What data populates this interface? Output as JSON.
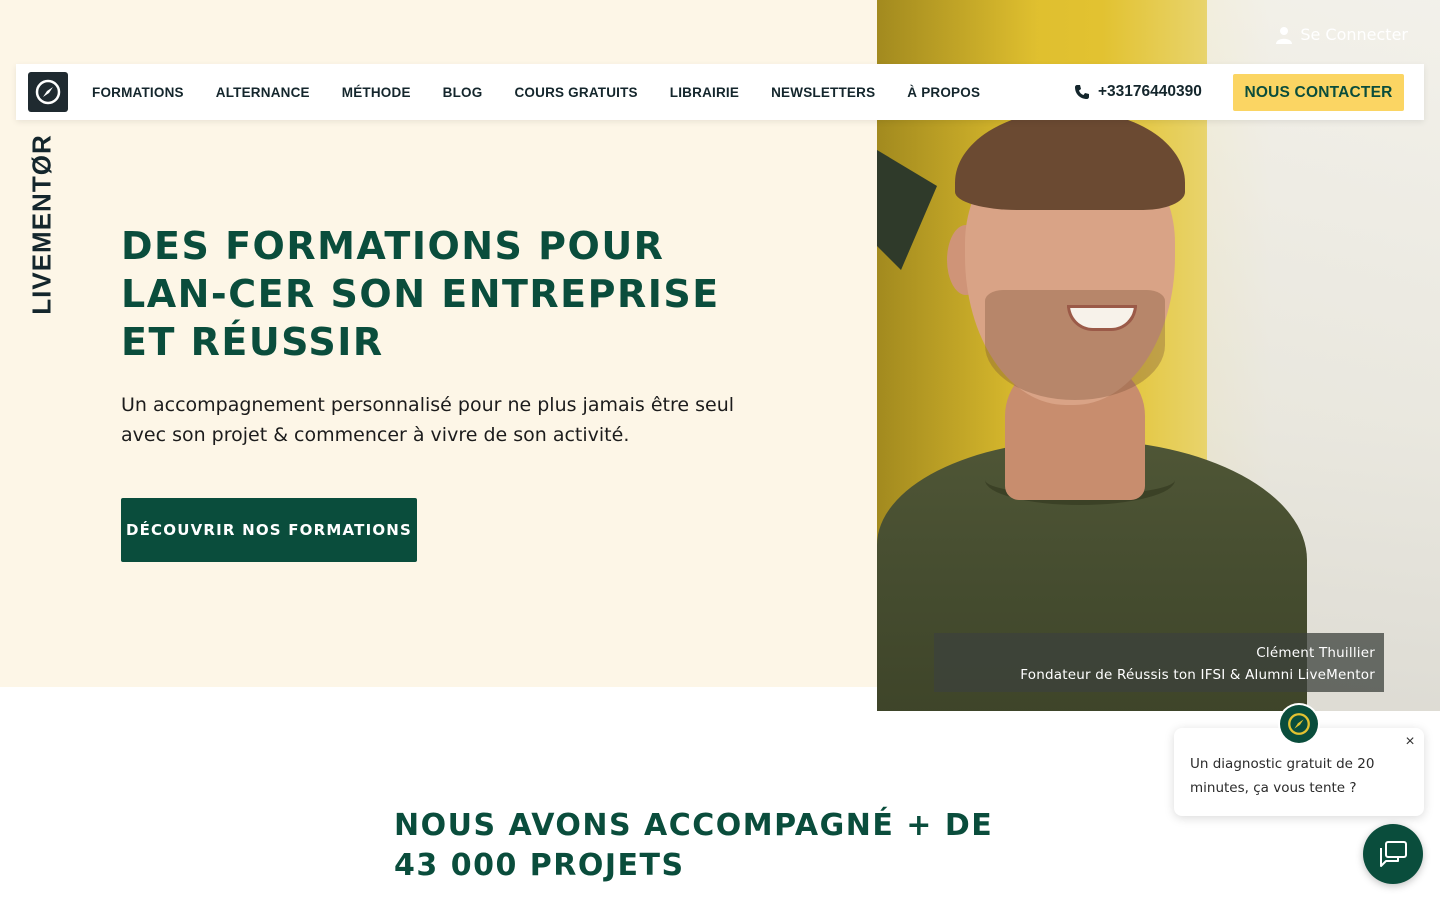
{
  "header": {
    "login_label": "Se Connecter",
    "brand_vertical": "LIVEMENTØR",
    "nav": [
      "FORMATIONS",
      "ALTERNANCE",
      "MÉTHODE",
      "BLOG",
      "COURS GRATUITS",
      "LIBRAIRIE",
      "NEWSLETTERS",
      "À PROPOS"
    ],
    "phone": "+33176440390",
    "contact_label": "NOUS CONTACTER"
  },
  "hero": {
    "title": "DES FORMATIONS POUR LAN-CER SON ENTREPRISE ET RÉUSSIR",
    "subtitle": "Un accompagnement personnalisé pour ne plus jamais être seul avec son projet & commencer à vivre de son activité.",
    "cta_label": "DÉCOUVRIR NOS FORMATIONS",
    "caption_name": "Clément Thuillier",
    "caption_role": "Fondateur de Réussis ton IFSI & Alumni LiveMentor"
  },
  "stats": {
    "title": "NOUS AVONS ACCOMPAGNÉ + DE 43 000 PROJETS"
  },
  "chat": {
    "message": "Un diagnostic gratuit de 20 minutes, ça vous tente ?",
    "close_label": "×"
  },
  "colors": {
    "brand_green": "#0a4d3c",
    "accent_yellow": "#fbd563",
    "hero_bg": "#fdf6e7"
  }
}
